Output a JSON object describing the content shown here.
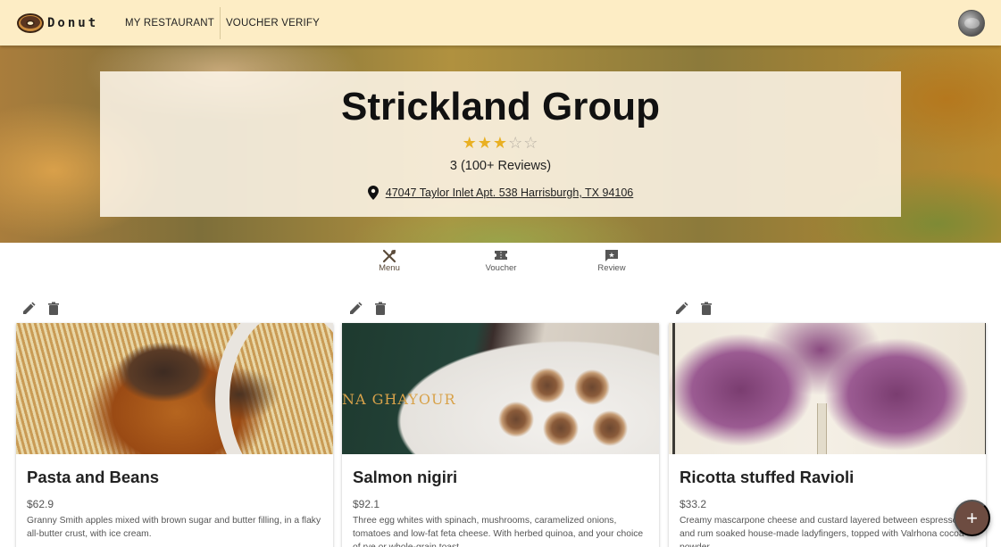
{
  "appbar": {
    "brand_name": "Donut",
    "nav": [
      {
        "label": "MY RESTAURANT"
      },
      {
        "label": "VOUCHER VERIFY"
      }
    ]
  },
  "restaurant": {
    "name": "Strickland Group",
    "rating": 3,
    "max_rating": 5,
    "rating_text": "3 (100+ Reviews)",
    "address": "47047 Taylor Inlet Apt. 538 Harrisburgh, TX 94106"
  },
  "tabs": [
    {
      "label": "Menu",
      "icon": "restaurant-utensils-icon",
      "active": true
    },
    {
      "label": "Voucher",
      "icon": "ticket-icon",
      "active": false
    },
    {
      "label": "Review",
      "icon": "rate-review-icon",
      "active": false
    }
  ],
  "menu_items": [
    {
      "name": "Pasta and Beans",
      "price": "$62.9",
      "description": "Granny Smith apples mixed with brown sugar and butter filling, in a flaky all-butter crust, with ice cream.",
      "image": "beef-noodle-soup"
    },
    {
      "name": "Salmon nigiri",
      "price": "$92.1",
      "description": "Three egg whites with spinach, mushrooms, caramelized onions, tomatoes and low-fat feta cheese. With herbed quinoa, and your choice of rye or whole-grain toast.",
      "image": "pastries-and-cookbook",
      "image_text": "NA GHAYOUR"
    },
    {
      "name": "Ricotta stuffed Ravioli",
      "price": "$33.2",
      "description": "Creamy mascarpone cheese and custard layered between espresso and rum soaked house-made ladyfingers, topped with Valrhona cocoa powder.",
      "image": "purple-iris-illustration"
    }
  ],
  "fab": {
    "label": "+"
  },
  "colors": {
    "appbar_bg": "#fdedc5",
    "star": "#e9b023",
    "fab": "#6d4c41",
    "active_tab": "#5b4b3a"
  }
}
